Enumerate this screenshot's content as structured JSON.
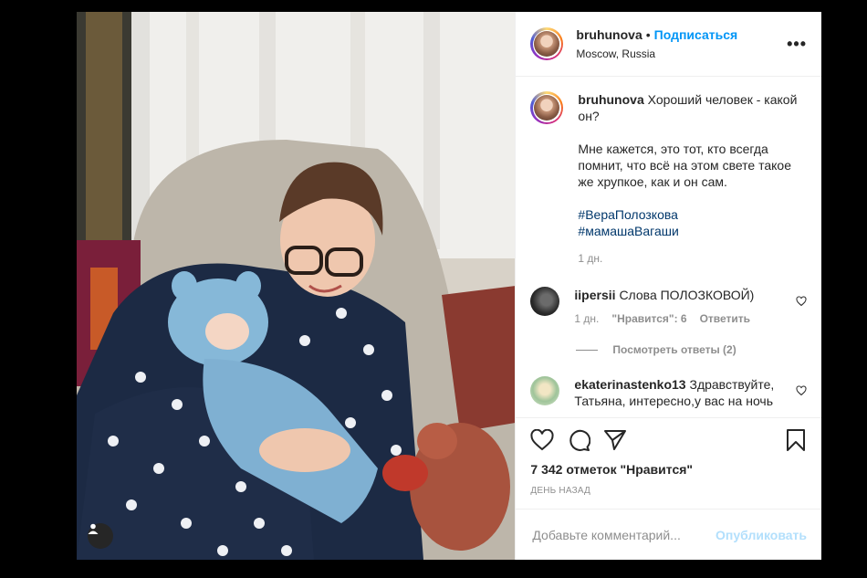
{
  "post": {
    "username": "bruhunova",
    "dot": "•",
    "follow_label": "Подписаться",
    "location": "Moscow, Russia",
    "more_icon": "more-options-icon",
    "more_glyph": "•••"
  },
  "caption": {
    "username": "bruhunova",
    "line1": "Хороший человек - какой он?",
    "line2": "Мне кажется, это тот, кто всегда помнит, что всё на этом свете такое же хрупкое, как и он сам.",
    "hashtags": [
      "#ВераПолозкова",
      "#мамашаВагаши"
    ],
    "time": "1 дн."
  },
  "comments": [
    {
      "username": "iipersii",
      "text": "Слова ПОЛОЗКОВОЙ)",
      "time": "1 дн.",
      "likes": "\"Нравится\": 6",
      "reply_label": "Ответить",
      "view_replies": "Посмотреть ответы (2)"
    },
    {
      "username": "ekaterinastenko13",
      "text": "Здравствуйте, Татьяна, интересно,у вас на ночь"
    }
  ],
  "actions": {
    "icons": [
      "heart-icon",
      "comment-icon",
      "share-icon",
      "bookmark-icon"
    ],
    "likes": "7 342 отметок \"Нравится\"",
    "date": "ДЕНЬ НАЗАД"
  },
  "add_comment": {
    "placeholder": "Добавьте комментарий...",
    "publish_label": "Опубликовать"
  },
  "colors": {
    "accent": "#0095f6",
    "publish_disabled": "#b2dffc",
    "hashtag": "#00376b",
    "muted": "#8e8e8e",
    "text": "#262626"
  }
}
